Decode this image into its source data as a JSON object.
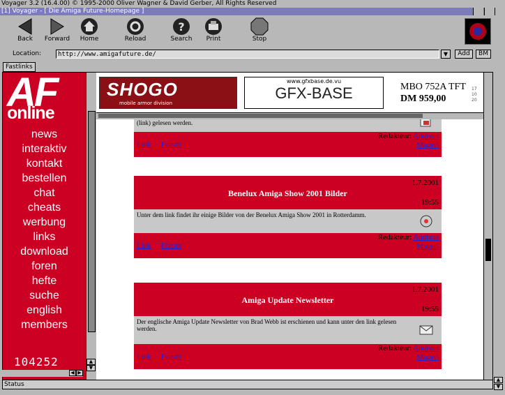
{
  "titlebar": "Voyager 3.2 (16.4.00) © 1995-2000 Oliver Wagner & David Gerber, All Rights Reserved",
  "window_title": "[1] Voyager - [ Die Amiga Future-Homepage ]",
  "toolbar": {
    "back": "Back",
    "forward": "Forward",
    "home": "Home",
    "reload": "Reload",
    "search": "Search",
    "print": "Print",
    "stop": "Stop"
  },
  "location": {
    "label": "Location:",
    "url": "http://www.amigafuture.de/",
    "add": "Add",
    "bm": "BM"
  },
  "fastlinks": "Fastlinks",
  "site": {
    "logo_af": "AF",
    "logo_online": "online",
    "nav": [
      "news",
      "interaktiv",
      "kontakt",
      "bestellen",
      "chat",
      "cheats",
      "werbung",
      "links",
      "download",
      "foren",
      "hefte",
      "suche",
      "english",
      "members"
    ],
    "counter": "104252"
  },
  "banners": {
    "shogo": "SHOGO",
    "shogo_sub": "mobile armor division",
    "gfx_url": "www.gfxbase.de.vu",
    "gfx_title": "GFX-BASE",
    "mbo_line1": "MBO 752A TFT",
    "mbo_line2": "DM  959,00",
    "mbo_small": [
      "17",
      "10",
      "20"
    ]
  },
  "news": {
    "partial_text": "(link) gelesen werden.",
    "link_label": "Link",
    "forum_label": "Forum",
    "redakteur_label": "Redakteur:",
    "author_first": "Andreas",
    "author_last": "Magerl",
    "stories": [
      {
        "date": "1.7.2001",
        "time": "19:55",
        "title": "Benelux Amiga Show 2001 Bilder",
        "text": "Unter dem link findet ihr einige Bilder von der Benelux Amiga Show 2001 in Rotterdamm."
      },
      {
        "date": "1.7.2001",
        "time": "19:55",
        "title": "Amiga Update Newsletter",
        "text": "Der englische Amiga Update Newsletter von Brad Webb ist erschienen und kann unter den link gelesen werden."
      }
    ]
  },
  "statusbar": "Status",
  "colors": {
    "af_red": "#cc0022",
    "link_blue": "#2222cc",
    "amiga_grey": "#b8b8b8",
    "window_blue": "#7c7cbc"
  }
}
